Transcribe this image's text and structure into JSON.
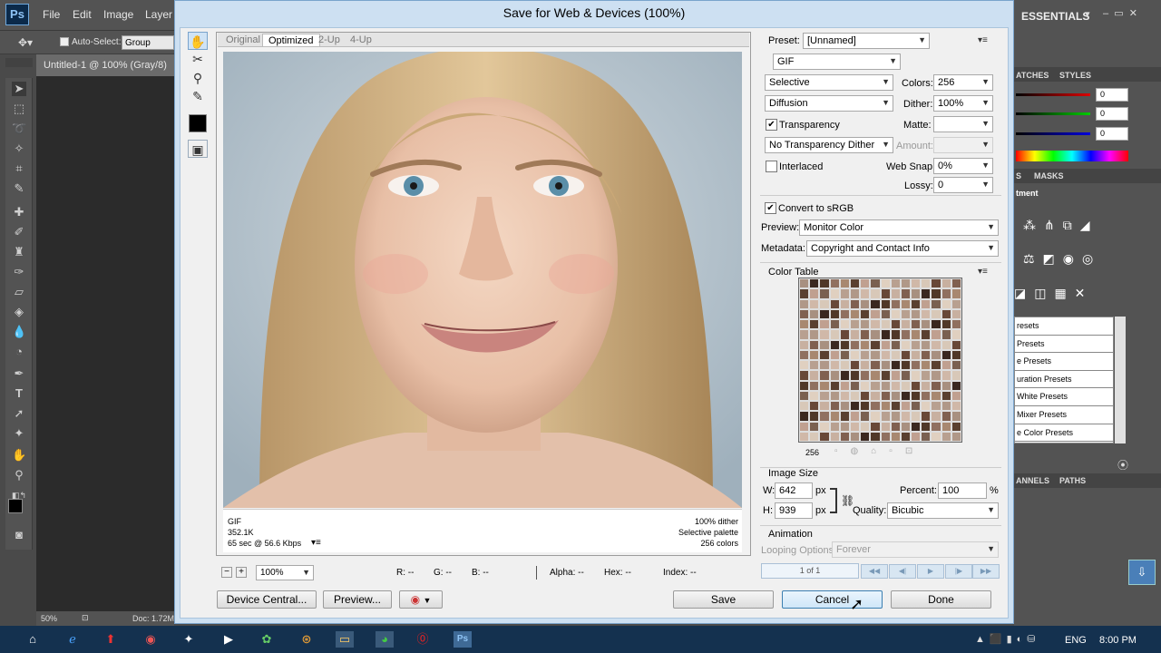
{
  "photoshop": {
    "logo": "Ps",
    "menu": [
      "File",
      "Edit",
      "Image",
      "Layer"
    ],
    "workspace": "ESSENTIALS",
    "options": {
      "auto_select_label": "Auto-Select:",
      "group_value": "Group"
    },
    "doc_tab": "Untitled-1 @ 100% (Gray/8)",
    "status": {
      "zoom": "50%",
      "doc": "Doc: 1.72M"
    },
    "panels": {
      "tabs_top": [
        "ATCHES",
        "STYLES"
      ],
      "color_values": [
        "0",
        "0",
        "0"
      ],
      "tabs_mid": [
        "S",
        "MASKS"
      ],
      "adjustments_title": "tment",
      "presets": [
        "resets",
        "Presets",
        "e Presets",
        "uration Presets",
        "White Presets",
        "Mixer Presets",
        "e Color Presets"
      ],
      "tabs_bottom": [
        "ANNELS",
        "PATHS"
      ]
    }
  },
  "dialog": {
    "title": "Save for Web & Devices (100%)",
    "view_tabs": [
      "Original",
      "Optimized",
      "2-Up",
      "4-Up"
    ],
    "active_view_tab": "Optimized",
    "preview_info": {
      "format": "GIF",
      "size": "352.1K",
      "time": "65 sec @ 56.6 Kbps",
      "dither": "100% dither",
      "palette": "Selective palette",
      "colors": "256 colors"
    },
    "zoom": "100%",
    "readouts": {
      "r": "R: --",
      "g": "G: --",
      "b": "B: --",
      "alpha": "Alpha: --",
      "hex": "Hex: --",
      "index": "Index: --"
    },
    "buttons": {
      "device_central": "Device Central...",
      "preview": "Preview...",
      "save": "Save",
      "cancel": "Cancel",
      "done": "Done"
    },
    "settings": {
      "preset_label": "Preset:",
      "preset_value": "[Unnamed]",
      "format_value": "GIF",
      "reduction_value": "Selective",
      "colors_label": "Colors:",
      "colors_value": "256",
      "dither_algo_value": "Diffusion",
      "dither_label": "Dither:",
      "dither_value": "100%",
      "transparency_label": "Transparency",
      "transparency_checked": true,
      "matte_label": "Matte:",
      "matte_value": "",
      "trans_dither_value": "No Transparency Dither",
      "amount_label": "Amount:",
      "interlaced_label": "Interlaced",
      "interlaced_checked": false,
      "web_snap_label": "Web Snap:",
      "web_snap_value": "0%",
      "lossy_label": "Lossy:",
      "lossy_value": "0",
      "convert_srgb_label": "Convert to sRGB",
      "convert_srgb_checked": true,
      "preview_label": "Preview:",
      "preview_value": "Monitor Color",
      "metadata_label": "Metadata:",
      "metadata_value": "Copyright and Contact Info"
    },
    "color_table": {
      "title": "Color Table",
      "count": "256",
      "swatches": [
        "#a89080",
        "#7a6050",
        "#c8b0a0",
        "#5a4030",
        "#d8c8b8",
        "#907060",
        "#b09888",
        "#3a2820",
        "#e0d0c0",
        "#806050",
        "#c0a090",
        "#684838",
        "#a88870",
        "#d0b8a8",
        "#503828",
        "#b8a090"
      ]
    },
    "image_size": {
      "title": "Image Size",
      "w_label": "W:",
      "w_value": "642",
      "h_label": "H:",
      "h_value": "939",
      "unit": "px",
      "percent_label": "Percent:",
      "percent_value": "100",
      "percent_unit": "%",
      "quality_label": "Quality:",
      "quality_value": "Bicubic"
    },
    "animation": {
      "title": "Animation",
      "looping_label": "Looping Options:",
      "looping_value": "Forever",
      "frame_counter": "1 of 1"
    }
  },
  "taskbar": {
    "lang": "ENG",
    "time": "8:00 PM"
  }
}
